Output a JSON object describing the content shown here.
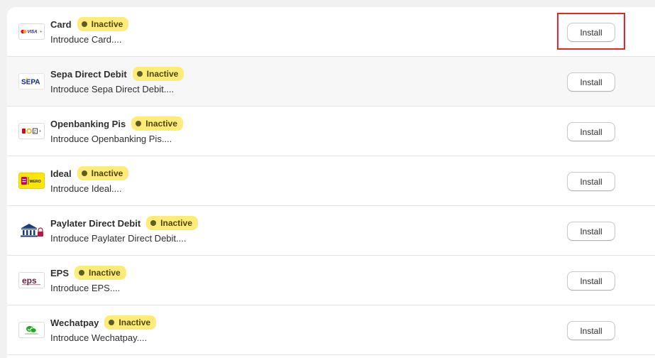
{
  "status_label": "Inactive",
  "install_label": "Install",
  "colors": {
    "badge_bg": "#ffeb78",
    "badge_text": "#4f4700",
    "highlight": "#e8262a"
  },
  "methods": [
    {
      "name": "Card",
      "desc": "Introduce Card....",
      "icon": "card-brands-icon",
      "logo_text": "VISA"
    },
    {
      "name": "Sepa Direct Debit",
      "desc": "Introduce Sepa Direct Debit....",
      "icon": "sepa-icon",
      "logo_text": "SEPA"
    },
    {
      "name": "Openbanking Pis",
      "desc": "Introduce Openbanking Pis....",
      "icon": "openbanking-icon"
    },
    {
      "name": "Ideal",
      "desc": "Introduce Ideal....",
      "icon": "ideal-wero-icon",
      "logo_text": "WERO"
    },
    {
      "name": "Paylater Direct Debit",
      "desc": "Introduce Paylater Direct Debit....",
      "icon": "bank-lock-icon"
    },
    {
      "name": "EPS",
      "desc": "Introduce EPS....",
      "icon": "eps-icon",
      "logo_text": "eps"
    },
    {
      "name": "Wechatpay",
      "desc": "Introduce Wechatpay....",
      "icon": "wechatpay-icon"
    }
  ]
}
